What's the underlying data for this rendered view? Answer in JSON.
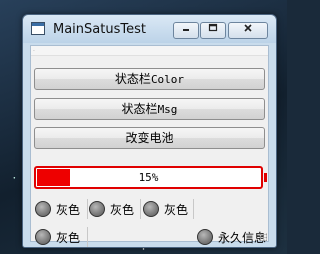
{
  "window": {
    "title": "MainSatusTest",
    "menubar_text": "."
  },
  "buttons": [
    {
      "label_prefix": "状态栏",
      "label_mono": "Color"
    },
    {
      "label_prefix": "状态栏",
      "label_mono": "Msg"
    },
    {
      "label_prefix": "改变电池",
      "label_mono": ""
    }
  ],
  "battery": {
    "level_percent": 15,
    "label": "15%",
    "color": "#ee0000"
  },
  "status_indicators": [
    {
      "label": "灰色",
      "state_color": "#808080"
    },
    {
      "label": "灰色",
      "state_color": "#808080"
    },
    {
      "label": "灰色",
      "state_color": "#808080"
    },
    {
      "label": "灰色",
      "state_color": "#808080"
    },
    {
      "label": "永久信息",
      "state_color": "#808080"
    }
  ],
  "icons": {
    "minimize": "minimize-icon",
    "maximize": "maximize-icon",
    "close": "close-icon"
  }
}
